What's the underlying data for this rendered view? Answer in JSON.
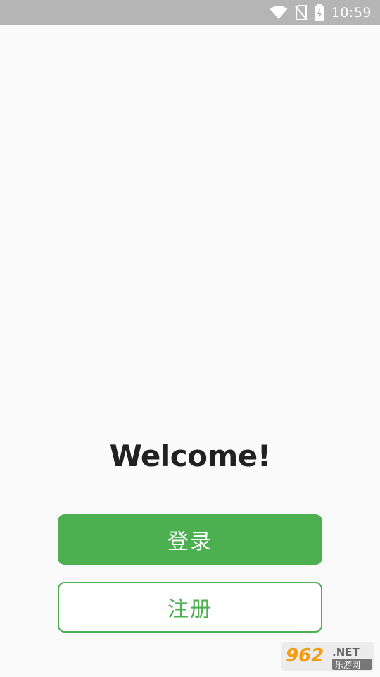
{
  "status_bar": {
    "time": "10:59",
    "icons": [
      "wifi-icon",
      "no-sim-icon",
      "battery-charging-icon"
    ]
  },
  "main": {
    "title": "Welcome!",
    "login_label": "登录",
    "register_label": "注册"
  },
  "watermark": {
    "text": "962.NET 乐游网"
  },
  "colors": {
    "accent": "#4caf50",
    "status_bar": "#b5b5b5",
    "background": "#fafafa",
    "title": "#212121"
  }
}
